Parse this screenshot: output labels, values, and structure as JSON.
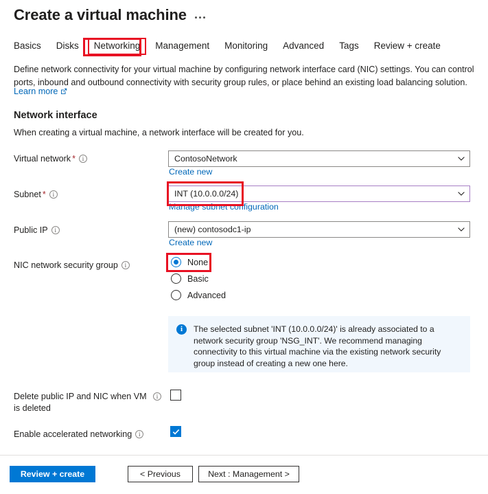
{
  "header": {
    "title": "Create a virtual machine",
    "more_menu": "more-options"
  },
  "tabs": [
    {
      "label": "Basics",
      "active": false
    },
    {
      "label": "Disks",
      "active": false
    },
    {
      "label": "Networking",
      "active": true
    },
    {
      "label": "Management",
      "active": false
    },
    {
      "label": "Monitoring",
      "active": false
    },
    {
      "label": "Advanced",
      "active": false
    },
    {
      "label": "Tags",
      "active": false
    },
    {
      "label": "Review + create",
      "active": false
    }
  ],
  "intro": {
    "paragraph": "Define network connectivity for your virtual machine by configuring network interface card (NIC) settings. You can control ports, inbound and outbound connectivity with security group rules, or place behind an existing load balancing solution.",
    "learn_more": "Learn more"
  },
  "section": {
    "title": "Network interface",
    "subtitle": "When creating a virtual machine, a network interface will be created for you."
  },
  "fields": {
    "virtual_network": {
      "label": "Virtual network",
      "required": "*",
      "value": "ContosoNetwork",
      "sublink": "Create new"
    },
    "subnet": {
      "label": "Subnet",
      "required": "*",
      "value": "INT (10.0.0.0/24)",
      "sublink": "Manage subnet configuration"
    },
    "public_ip": {
      "label": "Public IP",
      "required": "",
      "value": "(new) contosodc1-ip",
      "sublink": "Create new"
    },
    "nic_nsg": {
      "label": "NIC network security group",
      "options": [
        {
          "label": "None",
          "selected": true
        },
        {
          "label": "Basic",
          "selected": false
        },
        {
          "label": "Advanced",
          "selected": false
        }
      ]
    },
    "delete_public_ip": {
      "label": "Delete public IP and NIC when VM is deleted",
      "checked": false
    },
    "accelerated_networking": {
      "label": "Enable accelerated networking",
      "checked": true
    }
  },
  "info_banner": {
    "icon": "info-icon",
    "text": "The selected subnet 'INT (10.0.0.0/24)' is already associated to a network security group 'NSG_INT'. We recommend managing connectivity to this virtual machine via the existing network security group instead of creating a new one here."
  },
  "footer": {
    "review_create": "Review + create",
    "previous": "< Previous",
    "next": "Next : Management >"
  },
  "colors": {
    "accent": "#0078d4",
    "link": "#0067b8",
    "annotation": "#e81123",
    "required": "#a4262c",
    "field_focus": "#a77ec4",
    "info_bg": "#f1f7fd"
  }
}
